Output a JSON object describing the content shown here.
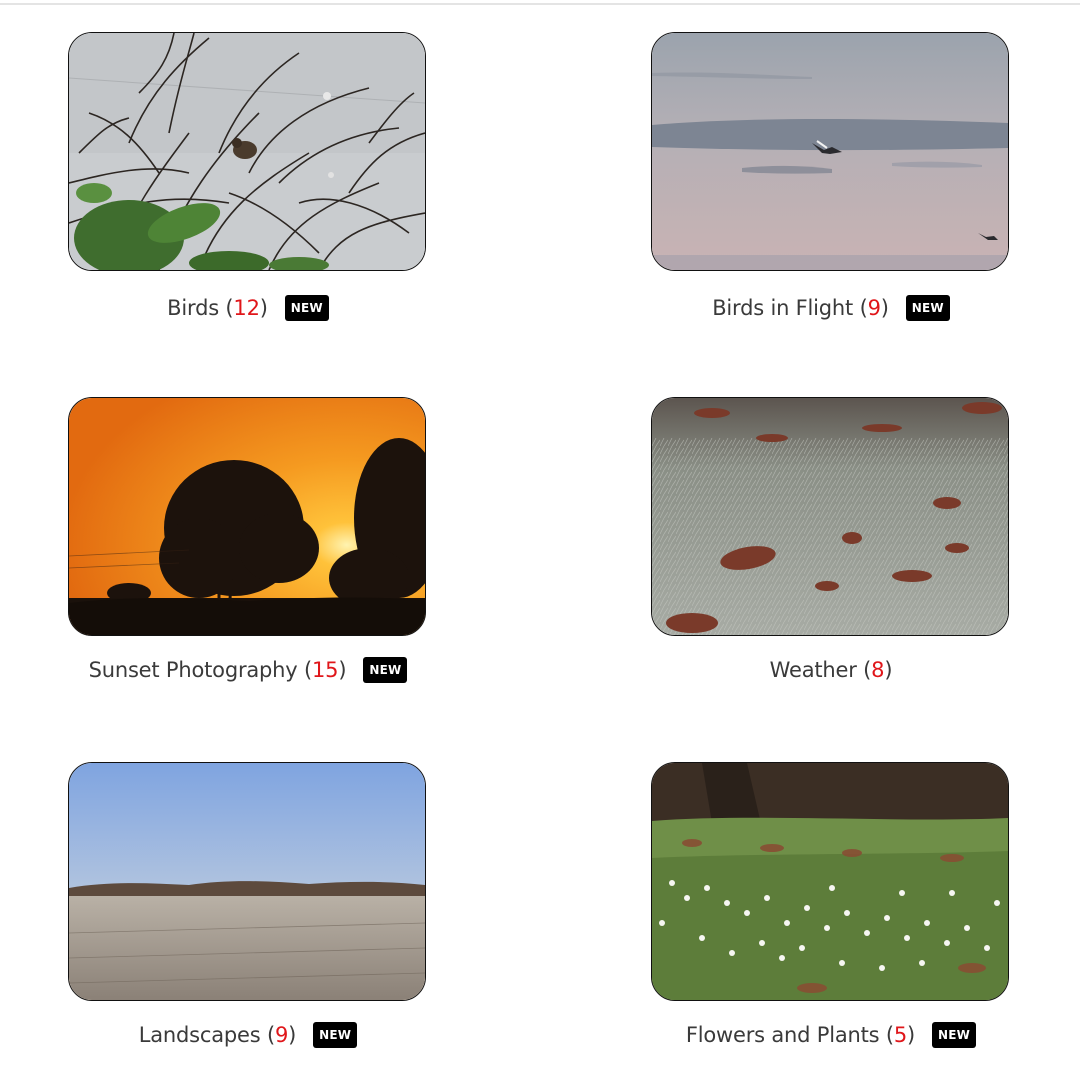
{
  "gallery": {
    "categories": [
      {
        "name": "Birds",
        "count": "12",
        "badge": "NEW"
      },
      {
        "name": "Birds in Flight",
        "count": "9",
        "badge": "NEW"
      },
      {
        "name": "Sunset Photography",
        "count": "15",
        "badge": "NEW"
      },
      {
        "name": "Weather",
        "count": "8",
        "badge": ""
      },
      {
        "name": "Landscapes",
        "count": "9",
        "badge": "NEW"
      },
      {
        "name": "Flowers and Plants",
        "count": "5",
        "badge": "NEW"
      }
    ]
  },
  "colors": {
    "count_text": "#e0161a",
    "badge_bg": "#000000",
    "caption_text": "#3a3a3a"
  }
}
